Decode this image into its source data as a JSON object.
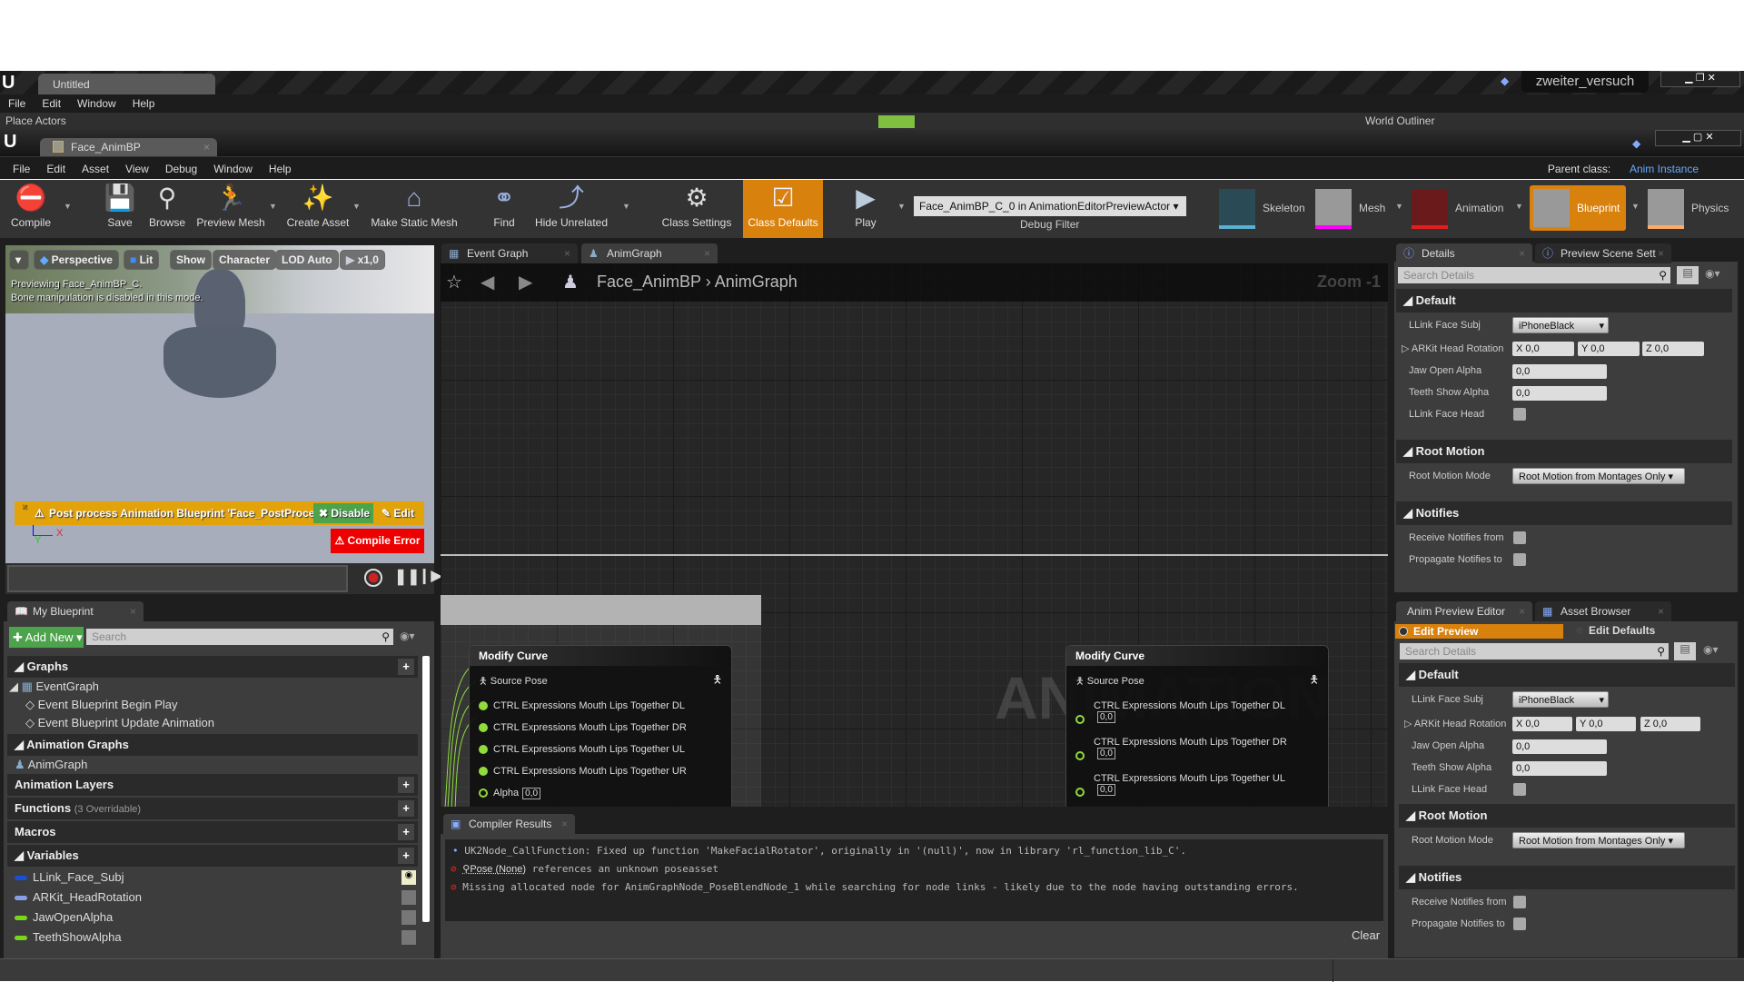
{
  "bg_window": {
    "tab": "Untitled",
    "menu": [
      "File",
      "Edit",
      "Window",
      "Help"
    ],
    "project": "zweiter_versuch",
    "place_actors": "Place Actors",
    "world_outliner": "World Outliner"
  },
  "window": {
    "tab": "Face_AnimBP",
    "menu": [
      "File",
      "Edit",
      "Asset",
      "View",
      "Debug",
      "Window",
      "Help"
    ],
    "parent_class_label": "Parent class:",
    "parent_class": "Anim Instance"
  },
  "toolbar": {
    "buttons": [
      {
        "label": "Compile",
        "icon": "compile-error-icon"
      },
      {
        "label": "Save",
        "icon": "save-icon"
      },
      {
        "label": "Browse",
        "icon": "browse-icon"
      },
      {
        "label": "Preview Mesh",
        "icon": "preview-mesh-icon"
      },
      {
        "label": "Create Asset",
        "icon": "create-asset-icon"
      },
      {
        "label": "Make Static Mesh",
        "icon": "static-mesh-icon"
      },
      {
        "label": "Find",
        "icon": "binoculars-icon"
      },
      {
        "label": "Hide Unrelated",
        "icon": "hide-unrelated-icon"
      },
      {
        "label": "Class Settings",
        "icon": "gear-icon"
      },
      {
        "label": "Class Defaults",
        "icon": "checklist-icon"
      },
      {
        "label": "Play",
        "icon": "play-icon"
      }
    ],
    "debug_filter_value": "Face_AnimBP_C_0 in AnimationEditorPreviewActor",
    "debug_filter_label": "Debug Filter",
    "modes": [
      {
        "label": "Skeleton",
        "color": "#5ab0d0"
      },
      {
        "label": "Mesh",
        "color": "#ff00ff"
      },
      {
        "label": "Animation",
        "color": "#e02020"
      },
      {
        "label": "Blueprint",
        "color": "#d8810d"
      },
      {
        "label": "Physics",
        "color": "#ffaa66"
      }
    ]
  },
  "viewport": {
    "buttons": [
      "Perspective",
      "Lit",
      "Show",
      "Character",
      "LOD Auto",
      "x1,0"
    ],
    "info1": "Previewing Face_AnimBP_C.",
    "info2": "Bone manipulation is disabled in this mode.",
    "warning": "Post process Animation Blueprint 'Face_PostProcess",
    "disable": "Disable",
    "edit": "Edit",
    "compile_error": "Compile Error",
    "axis_x": "X",
    "axis_y": "Y"
  },
  "my_blueprint": {
    "tab": "My Blueprint",
    "add_new": "Add New",
    "search_placeholder": "Search",
    "graphs": "Graphs",
    "event_graph": "EventGraph",
    "events": [
      "Event Blueprint Begin Play",
      "Event Blueprint Update Animation"
    ],
    "anim_graphs": "Animation Graphs",
    "anim_graph": "AnimGraph",
    "anim_layers": "Animation Layers",
    "functions": "Functions",
    "functions_note": "(3 Overridable)",
    "macros": "Macros",
    "variables": "Variables",
    "vars": [
      {
        "name": "LLink_Face_Subj",
        "color": "#1a4fd0"
      },
      {
        "name": "ARKit_HeadRotation",
        "color": "#8a9ee8"
      },
      {
        "name": "JawOpenAlpha",
        "color": "#7ad61a"
      },
      {
        "name": "TeethShowAlpha",
        "color": "#7ad61a"
      }
    ]
  },
  "graph": {
    "tabs": [
      "Event Graph",
      "AnimGraph"
    ],
    "breadcrumb": [
      "Face_AnimBP",
      "AnimGraph"
    ],
    "zoom": "Zoom -1",
    "watermark": "ANIMATION",
    "node1": {
      "title": "Modify Curve",
      "source": "Source Pose",
      "pins": [
        "CTRL Expressions Mouth Lips Together DL",
        "CTRL Expressions Mouth Lips Together DR",
        "CTRL Expressions Mouth Lips Together UL",
        "CTRL Expressions Mouth Lips Together UR"
      ],
      "alpha": "Alpha",
      "alpha_val": "0,0"
    },
    "node2": {
      "title": "Modify Curve",
      "source": "Source Pose",
      "pins": [
        "CTRL Expressions Mouth Lips Together DL",
        "CTRL Expressions Mouth Lips Together DR",
        "CTRL Expressions Mouth Lips Together UL"
      ],
      "val": "0,0"
    }
  },
  "compiler": {
    "tab": "Compiler Results",
    "messages": [
      "UK2Node_CallFunction: Fixed up function 'MakeFacialRotator', originally in '(null)', now in library 'rl_function_lib_C'.",
      "references an unknown poseasset",
      "Missing allocated node for AnimGraphNode_PoseBlendNode_1 while searching for node links - likely due to the node having outstanding errors."
    ],
    "pose_link": "Pose (None)",
    "clear": "Clear"
  },
  "details": {
    "tabs": [
      "Details",
      "Preview Scene Sett"
    ],
    "search_placeholder": "Search Details",
    "default": "Default",
    "face_subj": "LLink Face Subj",
    "face_subj_val": "iPhoneBlack",
    "head_rot": "ARKit Head Rotation",
    "x": "X",
    "y": "Y",
    "z": "Z",
    "zero": "0,0",
    "jaw": "Jaw Open Alpha",
    "teeth": "Teeth Show Alpha",
    "face_head": "LLink Face Head",
    "root_motion": "Root Motion",
    "root_motion_mode": "Root Motion Mode",
    "root_motion_val": "Root Motion from Montages Only",
    "notifies": "Notifies",
    "receive": "Receive Notifies from",
    "propagate": "Propagate Notifies to"
  },
  "preview": {
    "tabs": [
      "Anim Preview Editor",
      "Asset Browser"
    ],
    "edit_preview": "Edit Preview",
    "edit_defaults": "Edit Defaults"
  }
}
